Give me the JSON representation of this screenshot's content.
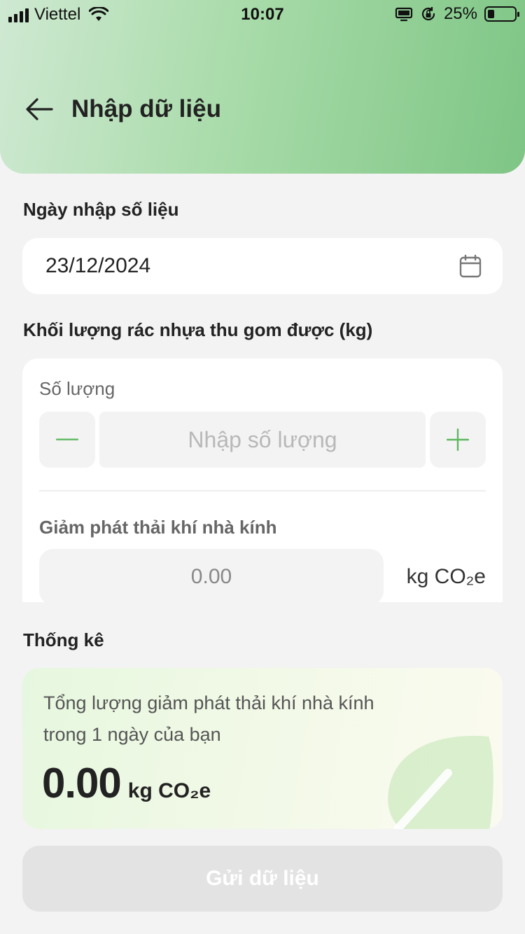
{
  "status_bar": {
    "carrier": "Viettel",
    "time": "10:07",
    "battery_percent": "25%",
    "battery_level": 0.25
  },
  "header": {
    "title": "Nhập dữ liệu"
  },
  "date_section": {
    "label": "Ngày nhập số liệu",
    "value": "23/12/2024"
  },
  "quantity_section": {
    "label": "Khối lượng rác nhựa thu gom được (kg)",
    "quantity_label": "Số lượng",
    "quantity_placeholder": "Nhập số lượng",
    "quantity_value": "",
    "ghg_label": "Giảm phát thải khí nhà kính",
    "ghg_value": "0.00",
    "ghg_unit": "kg CO₂e"
  },
  "stats_section": {
    "label": "Thống kê",
    "description": "Tổng lượng giảm phát thải khí nhà kính trong 1 ngày của bạn",
    "total_value": "0.00",
    "total_unit": "kg CO₂e"
  },
  "submit": {
    "label": "Gửi dữ liệu"
  },
  "colors": {
    "accent_green": "#5cb85f",
    "header_gradient_start": "#cfe9d2",
    "header_gradient_end": "#7ec585",
    "disabled_button": "#e3e3e3"
  }
}
